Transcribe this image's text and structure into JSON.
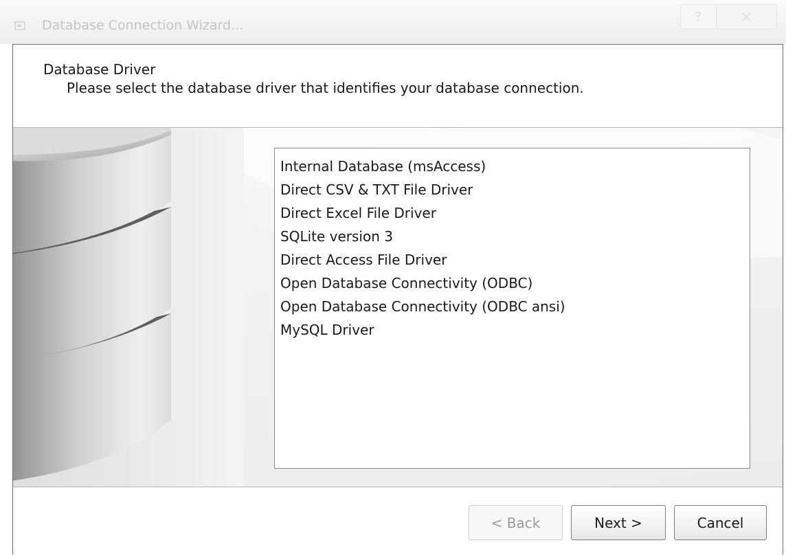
{
  "window": {
    "title": "Database Connection Wizard...",
    "help_label": "?",
    "close_label": "✕"
  },
  "header": {
    "title": "Database Driver",
    "subtitle": "Please select the database driver that identifies your database connection."
  },
  "drivers": [
    "Internal Database (msAccess)",
    "Direct CSV & TXT File Driver",
    "Direct Excel File Driver",
    "SQLite version 3",
    "Direct Access File Driver",
    "Open Database Connectivity (ODBC)",
    "Open Database Connectivity (ODBC ansi)",
    "MySQL Driver"
  ],
  "footer": {
    "back_label": "< Back",
    "next_label": "Next >",
    "cancel_label": "Cancel"
  },
  "icons": {
    "app": "window-app-icon",
    "art": "database-cylinder-icon"
  }
}
